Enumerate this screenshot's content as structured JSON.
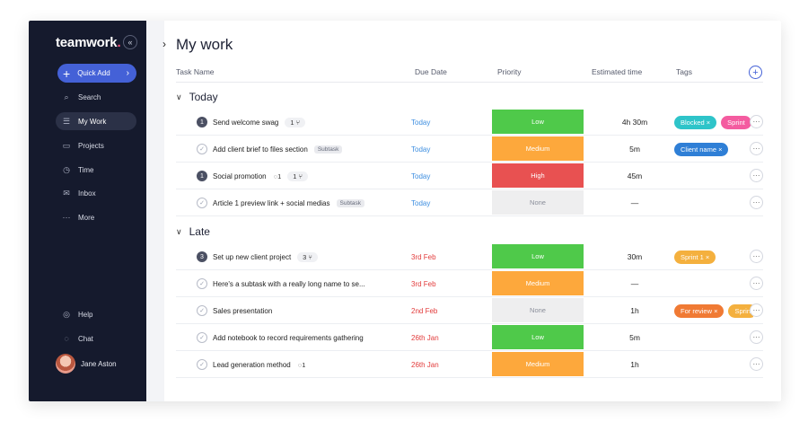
{
  "colors": {
    "sidebar_bg": "#151a2d",
    "accent": "#4461d7",
    "low": "#4fc94a",
    "medium": "#fda83c",
    "high": "#e85151",
    "none": "#eeeeef",
    "today": "#3d8ee0",
    "overdue": "#e23b3b"
  },
  "sidebar": {
    "logo": "teamwork",
    "logo_dot": ".",
    "collapse_icon": "«",
    "quick_add": "Quick Add",
    "items": [
      {
        "label": "Search",
        "icon": "search-icon",
        "glyph": "⌕"
      },
      {
        "label": "My Work",
        "icon": "list-icon",
        "glyph": "☰"
      },
      {
        "label": "Projects",
        "icon": "folder-icon",
        "glyph": "▭"
      },
      {
        "label": "Time",
        "icon": "stopwatch-icon",
        "glyph": "◷"
      },
      {
        "label": "Inbox",
        "icon": "inbox-icon",
        "glyph": "✉"
      },
      {
        "label": "More",
        "icon": "more-icon",
        "glyph": "···"
      }
    ],
    "bottom": [
      {
        "label": "Help",
        "icon": "help-icon",
        "glyph": "◎"
      },
      {
        "label": "Chat",
        "icon": "chat-icon",
        "glyph": "◌"
      }
    ],
    "user": "Jane Aston"
  },
  "main": {
    "title": "My work",
    "columns": {
      "task": "Task Name",
      "due": "Due Date",
      "priority": "Priority",
      "estimated": "Estimated time",
      "tags": "Tags"
    },
    "groups": [
      {
        "label": "Today"
      },
      {
        "label": "Late"
      }
    ],
    "rows": [
      {
        "number": "1",
        "name": "Send welcome swag",
        "count": "1",
        "due": "Today",
        "priority": "Low",
        "est": "4h 30m",
        "tags": [
          {
            "label": "Blocked ×",
            "color": "#2ec4c9"
          },
          {
            "label": "Sprint",
            "color": "#f45ca0"
          }
        ]
      },
      {
        "name": "Add client brief to files section",
        "badge": "Subtask",
        "due": "Today",
        "priority": "Medium",
        "est": "5m",
        "tags": [
          {
            "label": "Client name ×",
            "color": "#2f7fd6"
          }
        ]
      },
      {
        "number": "1",
        "name": "Social promotion",
        "comments": "1",
        "count": "1",
        "due": "Today",
        "priority": "High",
        "est": "45m",
        "tags": []
      },
      {
        "name": "Article 1 preview link + social medias",
        "badge": "Subtask",
        "due": "Today",
        "priority": "None",
        "est": "—",
        "tags": []
      },
      {
        "number": "3",
        "name": "Set up new client project",
        "count": "3",
        "due": "3rd Feb",
        "priority": "Low",
        "est": "30m",
        "tags": [
          {
            "label": "Sprint 1 ×",
            "color": "#f4b03e"
          }
        ]
      },
      {
        "name": "Here's a subtask with a really long name to se...",
        "due": "3rd Feb",
        "priority": "Medium",
        "est": "—",
        "tags": []
      },
      {
        "name": "Sales presentation",
        "due": "2nd Feb",
        "priority": "None",
        "est": "1h",
        "tags": [
          {
            "label": "For review ×",
            "color": "#f07a34"
          },
          {
            "label": "Sprin",
            "color": "#f4b03e"
          }
        ]
      },
      {
        "name": "Add notebook to record requirements gathering",
        "due": "26th Jan",
        "priority": "Low",
        "est": "5m",
        "tags": []
      },
      {
        "name": "Lead generation method",
        "comments": "1",
        "due": "26th Jan",
        "priority": "Medium",
        "est": "1h",
        "tags": []
      }
    ]
  }
}
